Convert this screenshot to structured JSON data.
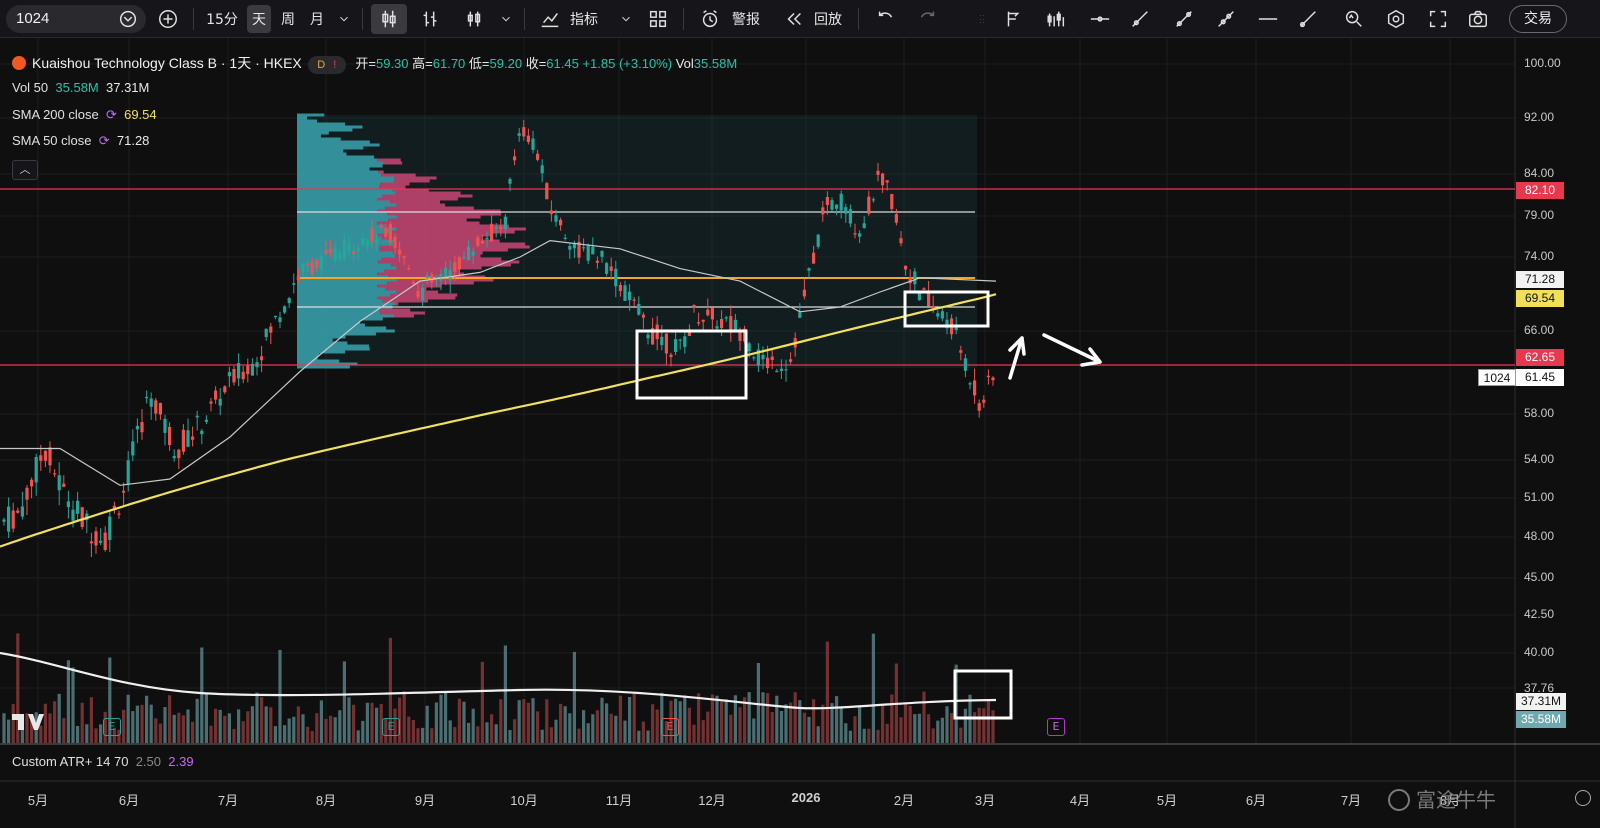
{
  "toolbar": {
    "symbol": "1024",
    "timeframes": [
      "15分",
      "天",
      "周",
      "月"
    ],
    "active_timeframe": "天",
    "indicators_label": "指标",
    "alert_label": "警报",
    "replay_label": "回放",
    "trade_label": "交易"
  },
  "legend": {
    "title": "Kuaishou Technology Class B · 1天 · HKEX",
    "badge_d": "D",
    "badge_bang": "!",
    "open_label": "开=",
    "open": "59.30",
    "high_label": "高=",
    "high": "61.70",
    "low_label": "低=",
    "low": "59.20",
    "close_label": "收=",
    "close": "61.45",
    "change": "+1.85 (+3.10%)",
    "vol_label": "Vol",
    "vol": "35.58M",
    "vol50_label": "Vol 50",
    "vol50_a": "35.58M",
    "vol50_b": "37.31M",
    "sma200_label": "SMA 200 close",
    "sma200": "69.54",
    "sma50_label": "SMA 50 close",
    "sma50": "71.28"
  },
  "price_axis": {
    "ticks": [
      "100.00",
      "92.00",
      "84.00",
      "79.00",
      "74.00",
      "66.00",
      "58.00",
      "54.00",
      "51.00",
      "48.00",
      "45.00",
      "42.50",
      "40.00",
      "37.76"
    ],
    "tag_resistance": "82.10",
    "tag_sma50": "71.28",
    "tag_sma200": "69.54",
    "tag_support": "62.65",
    "tag_symbol": "1024",
    "tag_last": "61.45",
    "tag_vol_ma": "37.31M",
    "tag_vol": "35.58M"
  },
  "time_axis": [
    "5月",
    "6月",
    "7月",
    "8月",
    "9月",
    "10月",
    "11月",
    "12月",
    "2026",
    "2月",
    "3月",
    "4月",
    "5月",
    "6月",
    "7月",
    "8月"
  ],
  "atr": {
    "label": "Custom ATR+ 14 70",
    "v1": "2.50",
    "v2": "2.39"
  },
  "watermark": "富途牛牛",
  "earnings_marker": "E",
  "colors": {
    "up": "#26a69a",
    "down": "#ef5350",
    "sma200": "#f0e05a",
    "sma50": "#c8c8c8",
    "level": "#e8384f",
    "poc": "#f5a623"
  },
  "chart_data": {
    "type": "candlestick",
    "title": "Kuaishou Technology Class B · 1天 · HKEX",
    "ylim": [
      45,
      100
    ],
    "horizontal_levels": [
      82.1,
      62.65,
      71.28
    ],
    "sma200_last": 69.54,
    "sma50_last": 71.28,
    "last_close": 61.45
  }
}
